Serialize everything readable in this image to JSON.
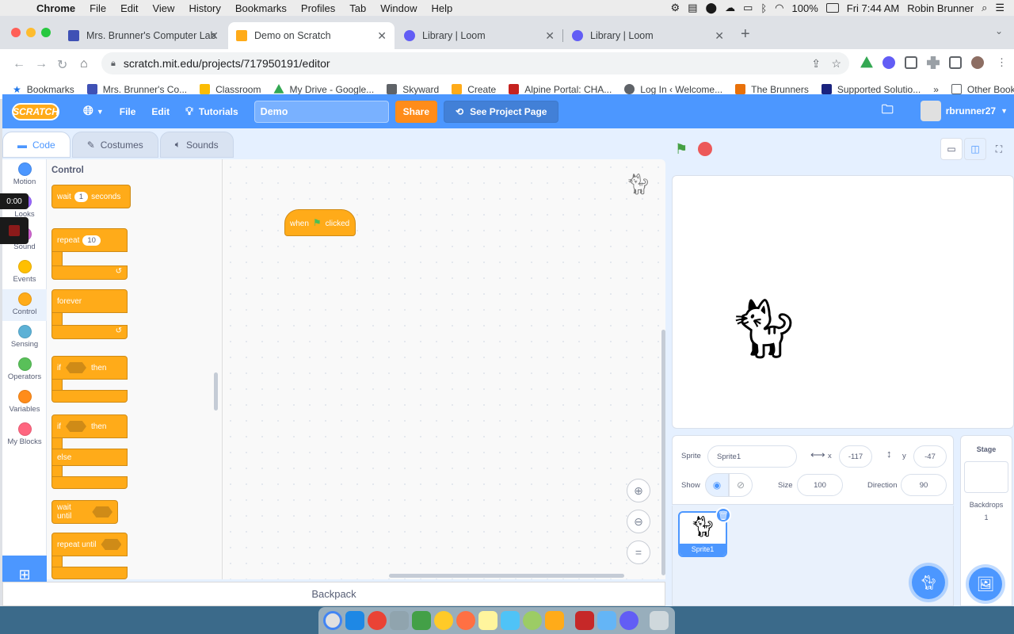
{
  "menubar": {
    "app": "Chrome",
    "items": [
      "File",
      "Edit",
      "View",
      "History",
      "Bookmarks",
      "Profiles",
      "Tab",
      "Window",
      "Help"
    ],
    "battery": "100%",
    "clock": "Fri 7:44 AM",
    "user": "Robin Brunner"
  },
  "tabs": [
    {
      "title": "Mrs. Brunner's Computer Lab"
    },
    {
      "title": "Demo on Scratch"
    },
    {
      "title": "Library | Loom"
    },
    {
      "title": "Library | Loom"
    }
  ],
  "address": {
    "url": "scratch.mit.edu/projects/717950191/editor"
  },
  "bookmarks": {
    "items": [
      "Bookmarks",
      "Mrs. Brunner's Co...",
      "Classroom",
      "My Drive - Google...",
      "Skyward",
      "Create",
      "Alpine Portal: CHA...",
      "Log In ‹ Welcome...",
      "The Brunners",
      "Supported Solutio..."
    ],
    "more": "»",
    "other": "Other Bookmarks"
  },
  "scratch": {
    "logo": "SCRATCH",
    "menu": {
      "file": "File",
      "edit": "Edit",
      "tutorials": "Tutorials",
      "share": "Share",
      "see_project": "See Project Page"
    },
    "project_title": "Demo",
    "username": "rbrunner27",
    "editor_tabs": {
      "code": "Code",
      "costumes": "Costumes",
      "sounds": "Sounds"
    },
    "categories": [
      "Motion",
      "Looks",
      "Sound",
      "Events",
      "Control",
      "Sensing",
      "Operators",
      "Variables",
      "My Blocks"
    ],
    "palette": {
      "heading": "Control",
      "wait": {
        "label": "wait",
        "value": "1",
        "suffix": "seconds"
      },
      "repeat": {
        "label": "repeat",
        "value": "10"
      },
      "forever": "forever",
      "if_then": {
        "if": "if",
        "then": "then"
      },
      "if_else": {
        "if": "if",
        "then": "then",
        "else": "else"
      },
      "wait_until": "wait until",
      "repeat_until": "repeat until"
    },
    "workspace": {
      "hat_when": "when",
      "hat_clicked": "clicked",
      "zoom_reset": "="
    },
    "backpack": "Backpack",
    "sprite_info": {
      "sprite_label": "Sprite",
      "sprite_name": "Sprite1",
      "x_label": "x",
      "x": "-117",
      "y_label": "y",
      "y": "-47",
      "show_label": "Show",
      "size_label": "Size",
      "size": "100",
      "direction_label": "Direction",
      "direction": "90"
    },
    "sprite_list": [
      {
        "name": "Sprite1"
      }
    ],
    "stage_pane": {
      "label": "Stage",
      "backdrops_label": "Backdrops",
      "backdrops_count": "1"
    }
  },
  "recording": {
    "time": "0:00"
  },
  "colors": {
    "scratch_blue": "#4c97ff",
    "control_orange": "#ffab19",
    "share_orange": "#ff8c1a",
    "stop_red": "#ec5959",
    "flag_green": "#45a043"
  },
  "category_colors": [
    "#4c97ff",
    "#9966ff",
    "#cf63cf",
    "#ffbf00",
    "#ffab19",
    "#5cb1d6",
    "#59c059",
    "#ff8c1a",
    "#ff6680"
  ]
}
